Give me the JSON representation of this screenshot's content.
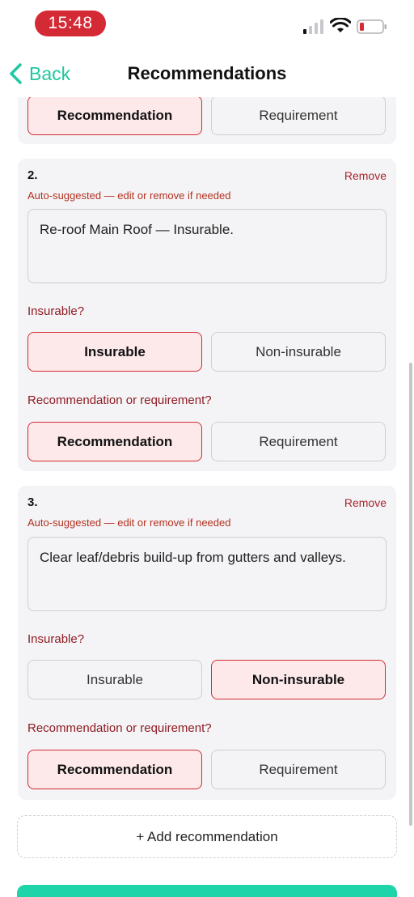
{
  "status_bar": {
    "time": "15:48"
  },
  "nav": {
    "back_label": "Back",
    "title": "Recommendations"
  },
  "top_card": {
    "options": [
      "Recommendation",
      "Requirement"
    ],
    "selected": "Recommendation"
  },
  "recommendations": [
    {
      "number": "2.",
      "remove_label": "Remove",
      "auto_note": "Auto-suggested — edit or remove if needed",
      "text": "Re-roof Main Roof — Insurable.",
      "insurable_question": "Insurable?",
      "insurable_options": [
        "Insurable",
        "Non-insurable"
      ],
      "insurable_selected": "Insurable",
      "type_question": "Recommendation or requirement?",
      "type_options": [
        "Recommendation",
        "Requirement"
      ],
      "type_selected": "Recommendation"
    },
    {
      "number": "3.",
      "remove_label": "Remove",
      "auto_note": "Auto-suggested — edit or remove if needed",
      "text": "Clear leaf/debris build-up from gutters and valleys.",
      "insurable_question": "Insurable?",
      "insurable_options": [
        "Insurable",
        "Non-insurable"
      ],
      "insurable_selected": "Non-insurable",
      "type_question": "Recommendation or requirement?",
      "type_options": [
        "Recommendation",
        "Requirement"
      ],
      "type_selected": "Recommendation"
    }
  ],
  "add_button_label": "+ Add recommendation",
  "colors": {
    "accent": "#1fc8a0",
    "danger": "#d42a35",
    "selected_bg": "#fde8ea",
    "question_text": "#8e1b22"
  }
}
